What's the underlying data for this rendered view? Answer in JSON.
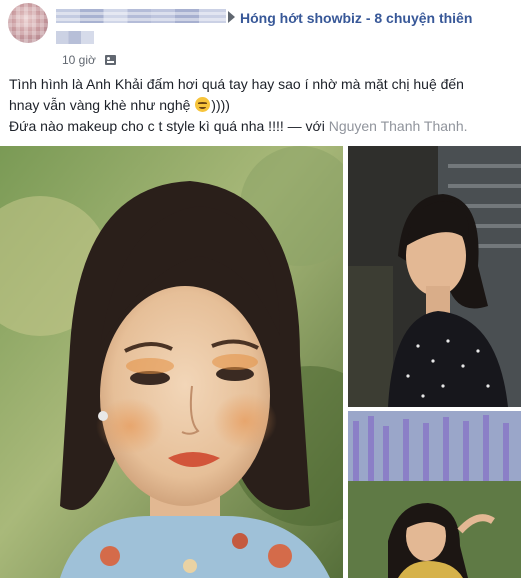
{
  "post": {
    "author_group": "Hóng hớt showbiz - 8 chuyện thiên",
    "timestamp": "10 giờ",
    "audience_icon": "group-audience-icon",
    "text_lines": [
      "Tình hình là Anh Khải đấm hơi quá tay hay sao í nhờ mà mặt chị huệ đến",
      "hnay vẫn vàng khè như nghệ",
      "))))",
      "Đứa nào makeup cho c t style kì quá nha !!!! — với ",
      "Nguyen Thanh Thanh."
    ],
    "emoji": "smiling-face-emoji"
  },
  "photos": [
    {
      "name": "photo-main",
      "icon": "portrait-photo"
    },
    {
      "name": "photo-top-right",
      "icon": "portrait-photo"
    },
    {
      "name": "photo-bottom-right",
      "icon": "portrait-photo"
    }
  ],
  "colors": {
    "link": "#385898",
    "text": "#1d2129",
    "meta": "#616770",
    "tag": "#90949c"
  }
}
